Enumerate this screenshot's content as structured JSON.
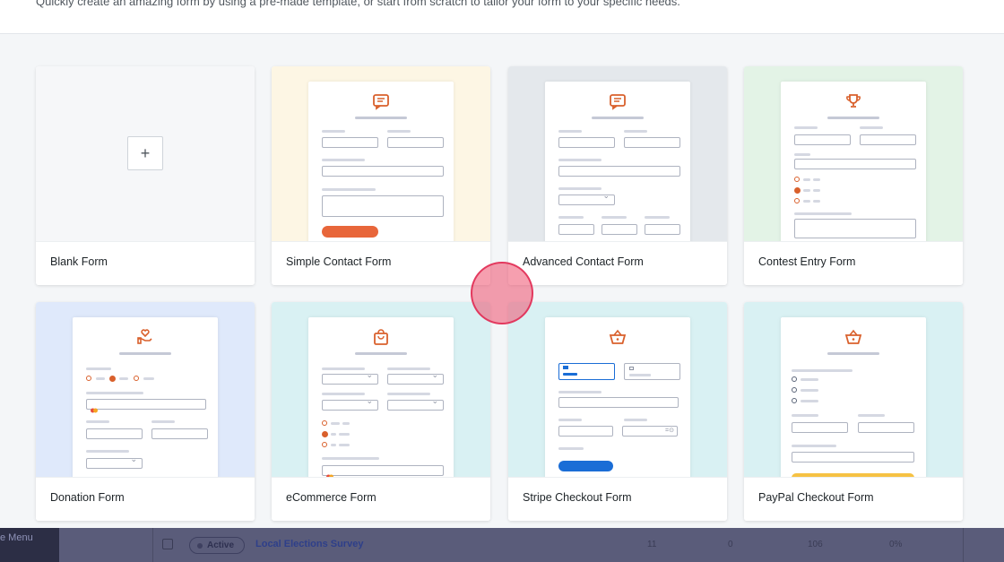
{
  "header": {
    "subtitle": "Quickly create an amazing form by using a pre-made template, or start from scratch to tailor your form to your specific needs."
  },
  "templates": [
    {
      "label": "Blank Form",
      "bg": "#f6f7f9",
      "icon": "+"
    },
    {
      "label": "Simple Contact Form",
      "bg": "#fdf6e4",
      "icon": "message-icon"
    },
    {
      "label": "Advanced Contact Form",
      "bg": "#e4e8ec",
      "icon": "message-icon"
    },
    {
      "label": "Contest Entry Form",
      "bg": "#e3f3e6",
      "icon": "trophy-icon"
    },
    {
      "label": "Donation Form",
      "bg": "#dfe9fb",
      "icon": "donation-hand-icon"
    },
    {
      "label": "eCommerce Form",
      "bg": "#d9f1f3",
      "icon": "shopping-bag-icon"
    },
    {
      "label": "Stripe Checkout Form",
      "bg": "#d9f1f3",
      "icon": "basket-icon"
    },
    {
      "label": "PayPal Checkout Form",
      "bg": "#d9f1f3",
      "icon": "basket-icon"
    }
  ],
  "colors": {
    "accent": "#d9602c",
    "stripe_button": "#1a6dd6",
    "paypal_button": "#f6c244"
  },
  "background_list": {
    "menu_label": "e Menu",
    "row": {
      "status": "Active",
      "title": "Local Elections Survey",
      "views": "11",
      "entries": "0",
      "partial": "106",
      "conversion": "0%"
    }
  }
}
